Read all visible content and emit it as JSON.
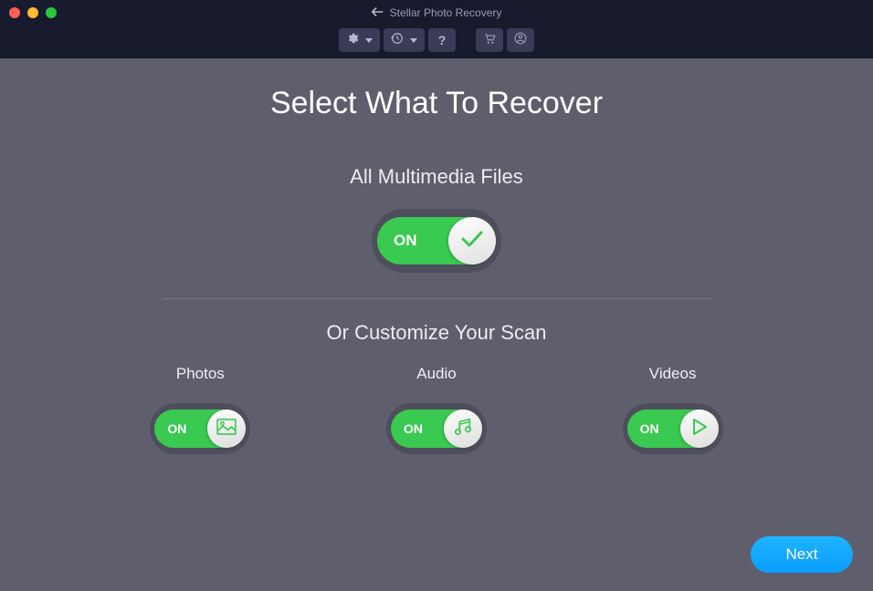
{
  "window": {
    "title": "Stellar Photo Recovery"
  },
  "main": {
    "heading": "Select What To Recover",
    "all_section_title": "All Multimedia Files",
    "customize_section_title": "Or Customize Your Scan",
    "toggle_on_label": "ON",
    "categories": {
      "photos": {
        "label": "Photos",
        "state": "ON"
      },
      "audio": {
        "label": "Audio",
        "state": "ON"
      },
      "videos": {
        "label": "Videos",
        "state": "ON"
      }
    },
    "all_toggle_state": "ON"
  },
  "footer": {
    "next_label": "Next"
  },
  "colors": {
    "accent_green": "#3ac951",
    "accent_blue": "#0fa8ff",
    "bg": "#5f5e6c",
    "titlebar": "#181a2e"
  }
}
